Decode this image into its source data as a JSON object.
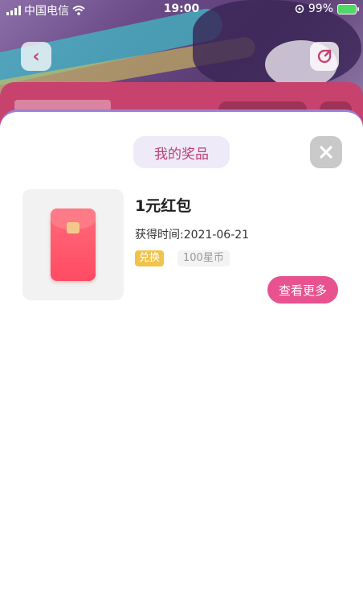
{
  "status_bar": {
    "carrier": "中国电信",
    "time": "19:00",
    "battery": "99%"
  },
  "header": {
    "back_icon": "chevron-left-icon",
    "share_icon": "share-icon"
  },
  "sheet": {
    "title": "我的奖品",
    "close_icon": "close-icon",
    "accent_color": "#e8528f",
    "border_color": "#9c80d6"
  },
  "prizes": [
    {
      "name": "1元红包",
      "obtained_time": "获得时间:2021-06-21",
      "status_tag": "兑换",
      "cost_tag": "100星币",
      "image_icon": "red-envelope-icon"
    }
  ],
  "actions": {
    "more_label": "查看更多"
  }
}
